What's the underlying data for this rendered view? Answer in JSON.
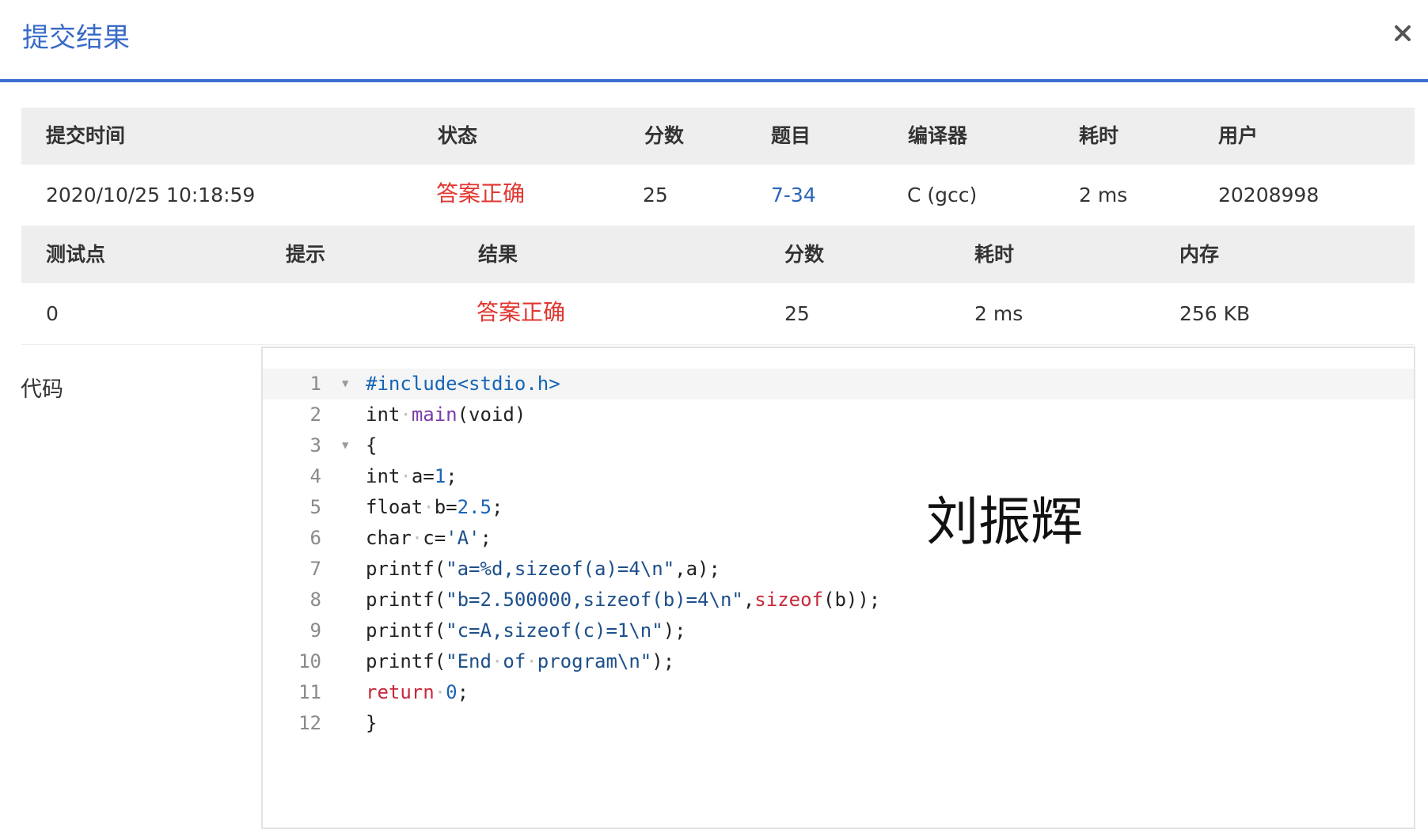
{
  "dialog": {
    "title": "提交结果",
    "close_icon": "close-icon"
  },
  "submission": {
    "headers": [
      "提交时间",
      "状态",
      "分数",
      "题目",
      "编译器",
      "耗时",
      "用户"
    ],
    "row": {
      "time": "2020/10/25 10:18:59",
      "status": "答案正确",
      "score": "25",
      "problem": "7-34",
      "compiler": "C (gcc)",
      "elapsed": "2 ms",
      "user": "20208998"
    }
  },
  "testcases": {
    "headers": [
      "测试点",
      "提示",
      "结果",
      "分数",
      "耗时",
      "内存"
    ],
    "rows": [
      {
        "id": "0",
        "hint": "",
        "result": "答案正确",
        "score": "25",
        "elapsed": "2 ms",
        "memory": "256 KB"
      }
    ]
  },
  "code": {
    "label": "代码",
    "line_numbers": [
      "1",
      "2",
      "3",
      "4",
      "5",
      "6",
      "7",
      "8",
      "9",
      "10",
      "11",
      "12"
    ],
    "lines": [
      "#include<stdio.h>",
      "int main(void)",
      "{",
      "int a=1;",
      "float b=2.5;",
      "char c='A';",
      "printf(\"a=%d,sizeof(a)=4\\n\",a);",
      "printf(\"b=2.500000,sizeof(b)=4\\n\",sizeof(b));",
      "printf(\"c=A,sizeof(c)=1\\n\");",
      "printf(\"End of program\\n\");",
      "return 0;",
      "}"
    ]
  },
  "watermark": "刘振辉",
  "colors": {
    "accent": "#3b6ed1",
    "success": "#e0362f",
    "link": "#2a64b8"
  }
}
